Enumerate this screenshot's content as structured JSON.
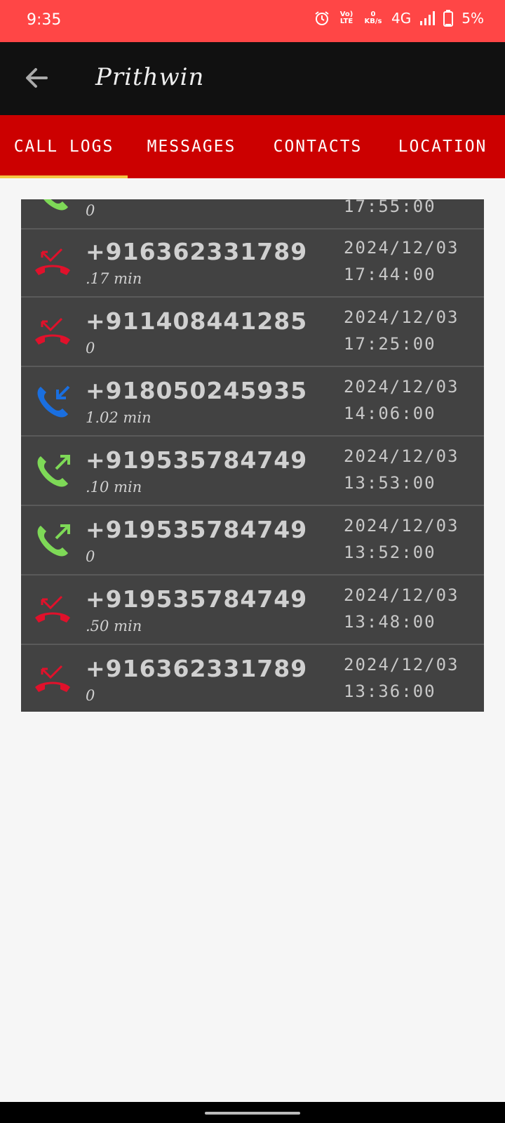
{
  "status_bar": {
    "time": "9:35",
    "volte": "Vo) LTE",
    "speed": "0 KB/s",
    "network": "4G",
    "battery": "5%"
  },
  "app_bar": {
    "title": "Prithwin",
    "back_icon": "arrow-left-icon"
  },
  "tabs": [
    {
      "label": "CALL LOGS",
      "selected": true
    },
    {
      "label": "MESSAGES",
      "selected": false
    },
    {
      "label": "CONTACTS",
      "selected": false
    },
    {
      "label": "LOCATION",
      "selected": false
    }
  ],
  "colors": {
    "status_bar": "#ff4646",
    "tab_bar": "#cc0000",
    "tab_indicator": "#f5c542",
    "missed": "#e0112b",
    "incoming": "#1a6fe0",
    "outgoing": "#7ed957"
  },
  "call_logs": [
    {
      "number": "",
      "duration": "0",
      "date": "",
      "time": "17:55:00",
      "type": "outgoing"
    },
    {
      "number": "+916362331789",
      "duration": ".17 min",
      "date": "2024/12/03",
      "time": "17:44:00",
      "type": "missed"
    },
    {
      "number": "+911408441285",
      "duration": "0",
      "date": "2024/12/03",
      "time": "17:25:00",
      "type": "missed"
    },
    {
      "number": "+918050245935",
      "duration": "1.02 min",
      "date": "2024/12/03",
      "time": "14:06:00",
      "type": "incoming"
    },
    {
      "number": "+919535784749",
      "duration": ".10 min",
      "date": "2024/12/03",
      "time": "13:53:00",
      "type": "outgoing"
    },
    {
      "number": "+919535784749",
      "duration": "0",
      "date": "2024/12/03",
      "time": "13:52:00",
      "type": "outgoing"
    },
    {
      "number": "+919535784749",
      "duration": ".50 min",
      "date": "2024/12/03",
      "time": "13:48:00",
      "type": "missed"
    },
    {
      "number": "+916362331789",
      "duration": "0",
      "date": "2024/12/03",
      "time": "13:36:00",
      "type": "missed"
    }
  ]
}
